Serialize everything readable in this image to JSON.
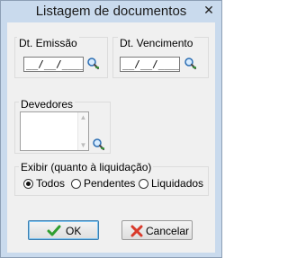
{
  "window": {
    "title": "Listagem de documentos",
    "close_glyph": "✕"
  },
  "emissao": {
    "label": "Dt. Emissão",
    "value": "__/__/____"
  },
  "vencimento": {
    "label": "Dt. Vencimento",
    "value": "__/__/____"
  },
  "devedores": {
    "label": "Devedores"
  },
  "liquidacao": {
    "label": "Exibir (quanto à liquidação)",
    "options": [
      "Todos",
      "Pendentes",
      "Liquidados"
    ],
    "selected": "Todos"
  },
  "buttons": {
    "ok": "OK",
    "cancel": "Cancelar"
  },
  "icons": {
    "lookup": "magnifier-lookup-icon",
    "ok": "green-check-icon",
    "cancel": "red-x-icon"
  },
  "colors": {
    "frame": "#c9daed",
    "check": "#2f9e2f",
    "cancel": "#d93a2b"
  }
}
